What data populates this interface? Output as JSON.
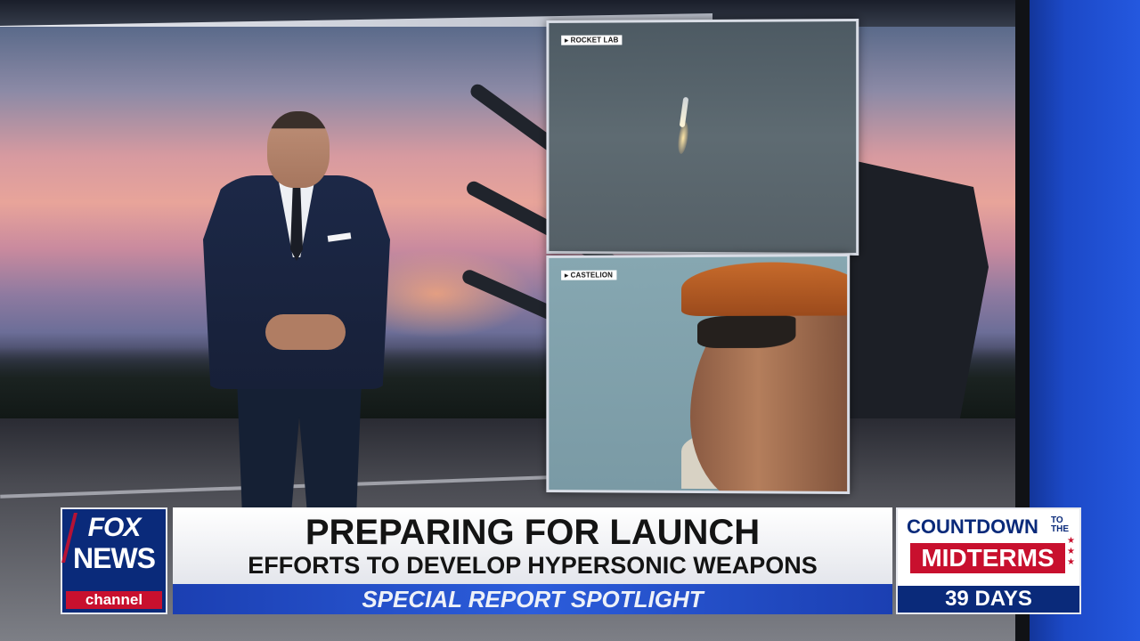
{
  "video": {
    "panel_top_source": "ROCKET LAB",
    "panel_bottom_source": "CASTELION"
  },
  "network": {
    "logo_line1": "FOX",
    "logo_line2": "NEWS",
    "logo_line3": "channel"
  },
  "lower_third": {
    "headline": "PREPARING FOR LAUNCH",
    "subheadline": "EFFORTS TO DEVELOP HYPERSONIC WEAPONS",
    "segment": "SPECIAL REPORT SPOTLIGHT"
  },
  "countdown": {
    "label": "COUNTDOWN",
    "to_the": "TO THE",
    "event": "MIDTERMS",
    "days": "39 DAYS"
  },
  "colors": {
    "fox_blue": "#0a2a7a",
    "fox_red": "#c8102e",
    "spotlight_blue": "#2c5ddb"
  }
}
